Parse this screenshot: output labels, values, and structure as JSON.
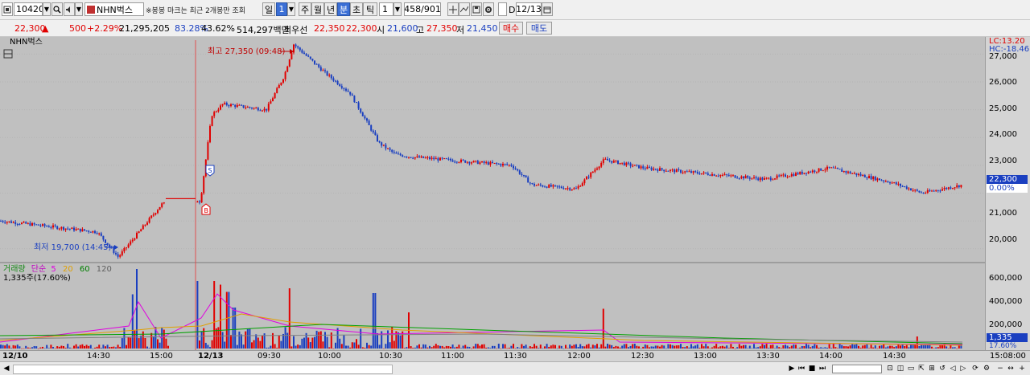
{
  "toolbar": {
    "code": "104200",
    "name": "NHN벅스",
    "notice": "※봉봉 마크는 최근 2개봉만 조회",
    "periods": [
      "일",
      "1",
      "주",
      "월",
      "년",
      "분",
      "초",
      "틱"
    ],
    "interval": "1",
    "count": "458/901",
    "date_checkbox": "D",
    "date": "12/13"
  },
  "quote": {
    "price": "22,300",
    "arrow": "▲",
    "change": "500",
    "change_pct": "+2.29%",
    "volume": "21,295,205",
    "vol_ratio": "83.28%",
    "pct2": "43.62%",
    "amount": "514,297백만",
    "best_label": "최우선",
    "best_ask": "22,350",
    "best_bid": "22,300",
    "open_label": "시",
    "open": "21,600",
    "high_label": "고",
    "high": "27,350",
    "low_label": "저",
    "low": "21,450",
    "buy": "매수",
    "sell": "매도"
  },
  "chart": {
    "title": "NHN벅스",
    "high_annotation": "최고 27,350 (09:48)",
    "low_annotation": "최저 19,700 (14:45)",
    "marker_s": "S",
    "marker_b": "B",
    "lc_label": "LC:13.20",
    "hc_label": "HC:-18.46",
    "current_price": "22,300",
    "current_pct": "0.00%",
    "price_ticks": [
      "27,000",
      "26,000",
      "25,000",
      "24,000",
      "23,000",
      "22,000",
      "21,000",
      "20,000"
    ],
    "volume_legend": {
      "name": "거래량",
      "ma_label": "단순",
      "ma": [
        "5",
        "20",
        "60",
        "120"
      ],
      "summary": "1,335주(17.60%)"
    },
    "volume_ticks": [
      "600,000",
      "400,000",
      "200,000"
    ],
    "volume_current": "1,335",
    "volume_pct": "17.60%",
    "colors": {
      "up": "#e00000",
      "down": "#1a3fc0",
      "bg": "#c0c0c0",
      "ma5": "#e000e0",
      "ma20": "#e0a000",
      "ma60": "#00a000",
      "ma120": "#808080"
    }
  },
  "xaxis": {
    "labels": [
      "12/10",
      "14:30",
      "15:00",
      "12/13",
      "09:30",
      "10:00",
      "10:30",
      "11:00",
      "11:30",
      "12:00",
      "12:30",
      "13:00",
      "13:30",
      "14:00",
      "14:30",
      "15:08:00"
    ]
  },
  "chart_data": {
    "type": "line",
    "title": "",
    "xlabel": "",
    "ylabel": "",
    "x": [
      "12/10 14:00",
      "12/10 14:30",
      "12/10 14:45",
      "12/10 15:00",
      "12/10 15:20",
      "12/13 09:00",
      "12/13 09:10",
      "12/13 09:20",
      "12/13 09:30",
      "12/13 09:40",
      "12/13 09:48",
      "12/13 10:00",
      "12/13 10:20",
      "12/13 10:30",
      "12/13 10:45",
      "12/13 11:00",
      "12/13 11:30",
      "12/13 11:45",
      "12/13 12:00",
      "12/13 12:15",
      "12/13 12:30",
      "12/13 13:00",
      "12/13 13:30",
      "12/13 14:00",
      "12/13 14:30",
      "12/13 14:45",
      "12/13 15:08"
    ],
    "series": [
      {
        "name": "",
        "values": [
          21000,
          20600,
          19700,
          21600,
          21800,
          21700,
          24800,
          25200,
          25000,
          26200,
          27350,
          26300,
          25600,
          23800,
          23400,
          23300,
          23000,
          22300,
          22150,
          23200,
          22900,
          22700,
          22500,
          22900,
          22400,
          22000,
          22300
        ]
      }
    ],
    "ylim": [
      19500,
      27500
    ],
    "volume": {
      "ylim": [
        0,
        700000
      ],
      "ticks": [
        600000,
        400000,
        200000
      ],
      "current": 1335
    }
  }
}
